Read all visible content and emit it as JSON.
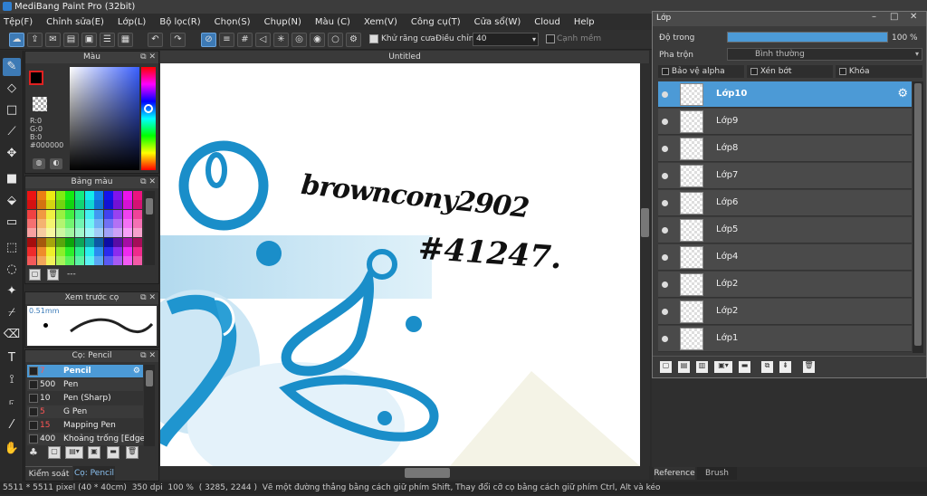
{
  "title": "MediBang Paint Pro (32bit)",
  "menu": [
    "Tệp(F)",
    "Chỉnh sửa(E)",
    "Lớp(L)",
    "Bộ lọc(R)",
    "Chọn(S)",
    "Chụp(N)",
    "Màu (C)",
    "Xem(V)",
    "Công cụ(T)",
    "Cửa sổ(W)",
    "Cloud",
    "Help"
  ],
  "toolbar": {
    "antialias_label": "Khử răng cưa",
    "adjust_label": "Điều chỉnh",
    "adjust_value": "40",
    "edge_label": "Cạnh mềm"
  },
  "color_panel": {
    "title": "Màu",
    "r": "R:0",
    "g": "G:0",
    "b": "B:0",
    "hex": "#000000"
  },
  "palette_panel": {
    "title": "Bảng màu",
    "dashes": "---"
  },
  "preview_panel": {
    "title": "Xem trước cọ",
    "size": "0.51mm"
  },
  "brush_panel": {
    "title": "Cọ: Pencil",
    "items": [
      {
        "size": "7",
        "name": "Pencil",
        "size_color": "#ff5555",
        "selected": true
      },
      {
        "size": "500",
        "name": "Pen",
        "size_color": "#eeeeee"
      },
      {
        "size": "10",
        "name": "Pen (Sharp)",
        "size_color": "#eeeeee"
      },
      {
        "size": "5",
        "name": "G Pen",
        "size_color": "#ff5555"
      },
      {
        "size": "15",
        "name": "Mapping Pen",
        "size_color": "#ff5555"
      },
      {
        "size": "400",
        "name": "Khoảng trống [Edge I",
        "size_color": "#eeeeee"
      }
    ]
  },
  "bottom_tabs": [
    "Kiểm soát cọ",
    "Cọ: Pencil"
  ],
  "canvas": {
    "tab_title": "Untitled",
    "text1": "browncony2902",
    "text2": "#41247."
  },
  "layer_window": {
    "title": "Lớp",
    "opacity_label": "Độ trong",
    "opacity_value": "100 %",
    "opacity_fraction": 1.0,
    "blend_label": "Pha trộn",
    "blend_value": "Bình thường",
    "protect_alpha": "Bảo vệ alpha",
    "clipping": "Xén bớt",
    "lock": "Khóa",
    "layers": [
      {
        "name": "Lớp10",
        "selected": true
      },
      {
        "name": "Lớp9"
      },
      {
        "name": "Lớp8"
      },
      {
        "name": "Lớp7"
      },
      {
        "name": "Lớp6"
      },
      {
        "name": "Lớp5"
      },
      {
        "name": "Lớp4"
      },
      {
        "name": "Lớp2"
      },
      {
        "name": "Lớp2"
      },
      {
        "name": "Lớp1"
      }
    ]
  },
  "right_tabs": [
    "Reference",
    "Brush Size"
  ],
  "statusbar": {
    "dims": "5511 * 5511 pixel",
    "cm": "(40 * 40cm)",
    "dpi": "350 dpi",
    "zoom": "100 %",
    "coords": "( 3285, 2244 )",
    "hint": "Vẽ một đường thẳng bằng cách giữ phím Shift, Thay đổi cỡ cọ bằng cách giữ phím Ctrl, Alt và kéo"
  }
}
